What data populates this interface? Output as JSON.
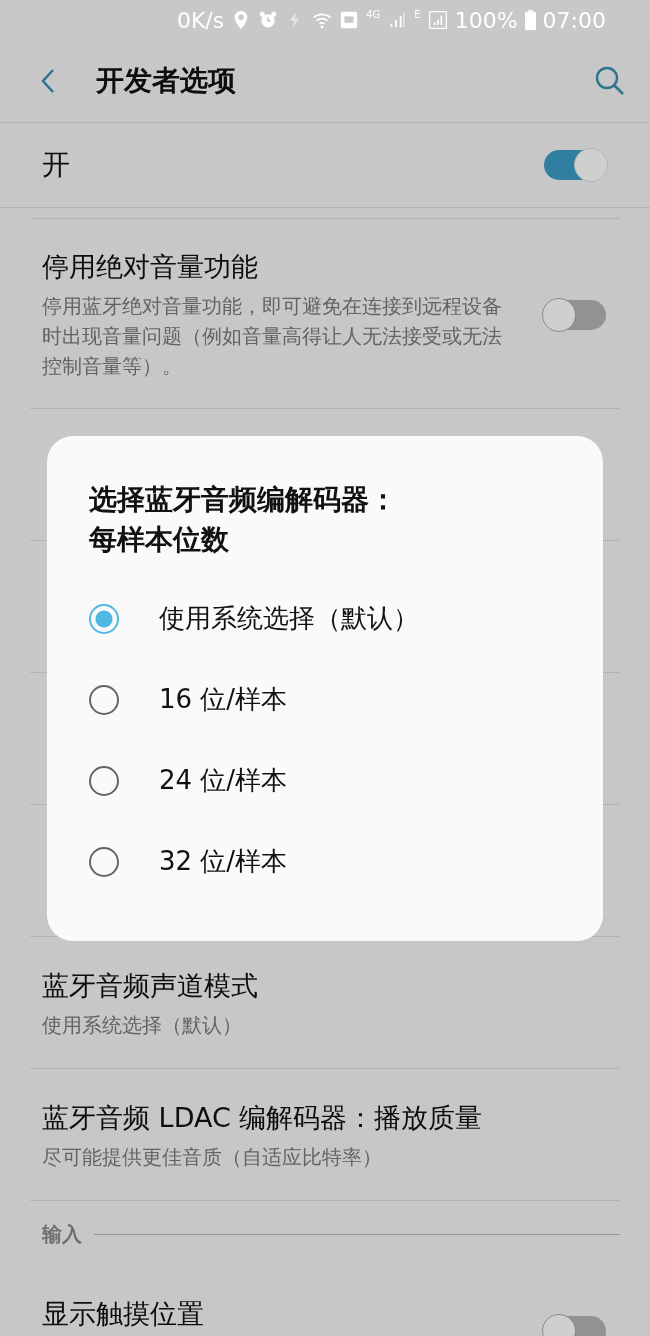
{
  "status_bar": {
    "network_speed": "0K/s",
    "network_type": "4G",
    "secondary_network": "E",
    "battery": "100%",
    "time": "07:00"
  },
  "header": {
    "title": "开发者选项"
  },
  "master_switch": {
    "label": "开",
    "on": true
  },
  "settings_top": [
    {
      "kind": "switch",
      "title": "停用绝对音量功能",
      "subtitle": "停用蓝牙绝对音量功能，即可避免在连接到远程设备时出现音量问题（例如音量高得让人无法接受或无法控制音量等）。",
      "on": false
    }
  ],
  "settings_bottom": [
    {
      "kind": "text",
      "title": "蓝牙音频声道模式",
      "subtitle": "使用系统选择（默认）"
    },
    {
      "kind": "text",
      "title": "蓝牙音频 LDAC 编解码器：播放质量",
      "subtitle": "尽可能提供更佳音质（自适应比特率）"
    },
    {
      "kind": "header",
      "title": "输入"
    },
    {
      "kind": "switch",
      "title": "显示触摸位置",
      "on": false
    }
  ],
  "dialog": {
    "title": "选择蓝牙音频编解码器：每样本位数",
    "options": [
      {
        "label": "使用系统选择（默认）",
        "selected": true
      },
      {
        "label": "16 位/样本",
        "selected": false
      },
      {
        "label": "24 位/样本",
        "selected": false
      },
      {
        "label": "32 位/样本",
        "selected": false
      }
    ]
  }
}
